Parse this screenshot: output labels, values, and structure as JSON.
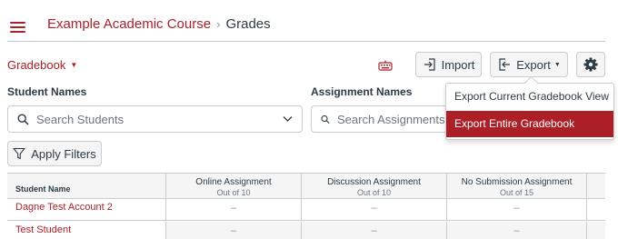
{
  "header": {
    "course": "Example Academic Course",
    "separator": "›",
    "current": "Grades"
  },
  "toolbar": {
    "gradebook_menu": "Gradebook",
    "import_label": "Import",
    "export_label": "Export"
  },
  "filters": {
    "student_names_label": "Student Names",
    "assignment_names_label": "Assignment Names",
    "search_students_placeholder": "Search Students",
    "search_assignments_placeholder": "Search Assignments",
    "apply_filters_label": "Apply Filters"
  },
  "export_menu": {
    "items": [
      "Export Current Gradebook View",
      "Export Entire Gradebook"
    ],
    "highlighted": "Export Entire Gradebook"
  },
  "grid": {
    "student_col": "Student Name",
    "assignments": [
      {
        "name": "Online Assignment",
        "points": "Out of 10"
      },
      {
        "name": "Discussion Assignment",
        "points": "Out of 10"
      },
      {
        "name": "No Submission Assignment",
        "points": "Out of 15"
      }
    ],
    "students": [
      {
        "name": "Dagne Test Account 2",
        "grades": [
          "–",
          "–",
          "–"
        ]
      },
      {
        "name": "Test Student",
        "grades": [
          "–",
          "–",
          "–"
        ]
      }
    ]
  },
  "colors": {
    "accent": "#ad1f26",
    "text": "#2d3b45",
    "border": "#c7cdd1"
  },
  "icons": [
    "hamburger-menu-icon",
    "keyboard-shortcuts-icon",
    "import-icon",
    "export-icon",
    "gear-icon",
    "search-icon",
    "chevron-down-icon",
    "filter-icon"
  ]
}
